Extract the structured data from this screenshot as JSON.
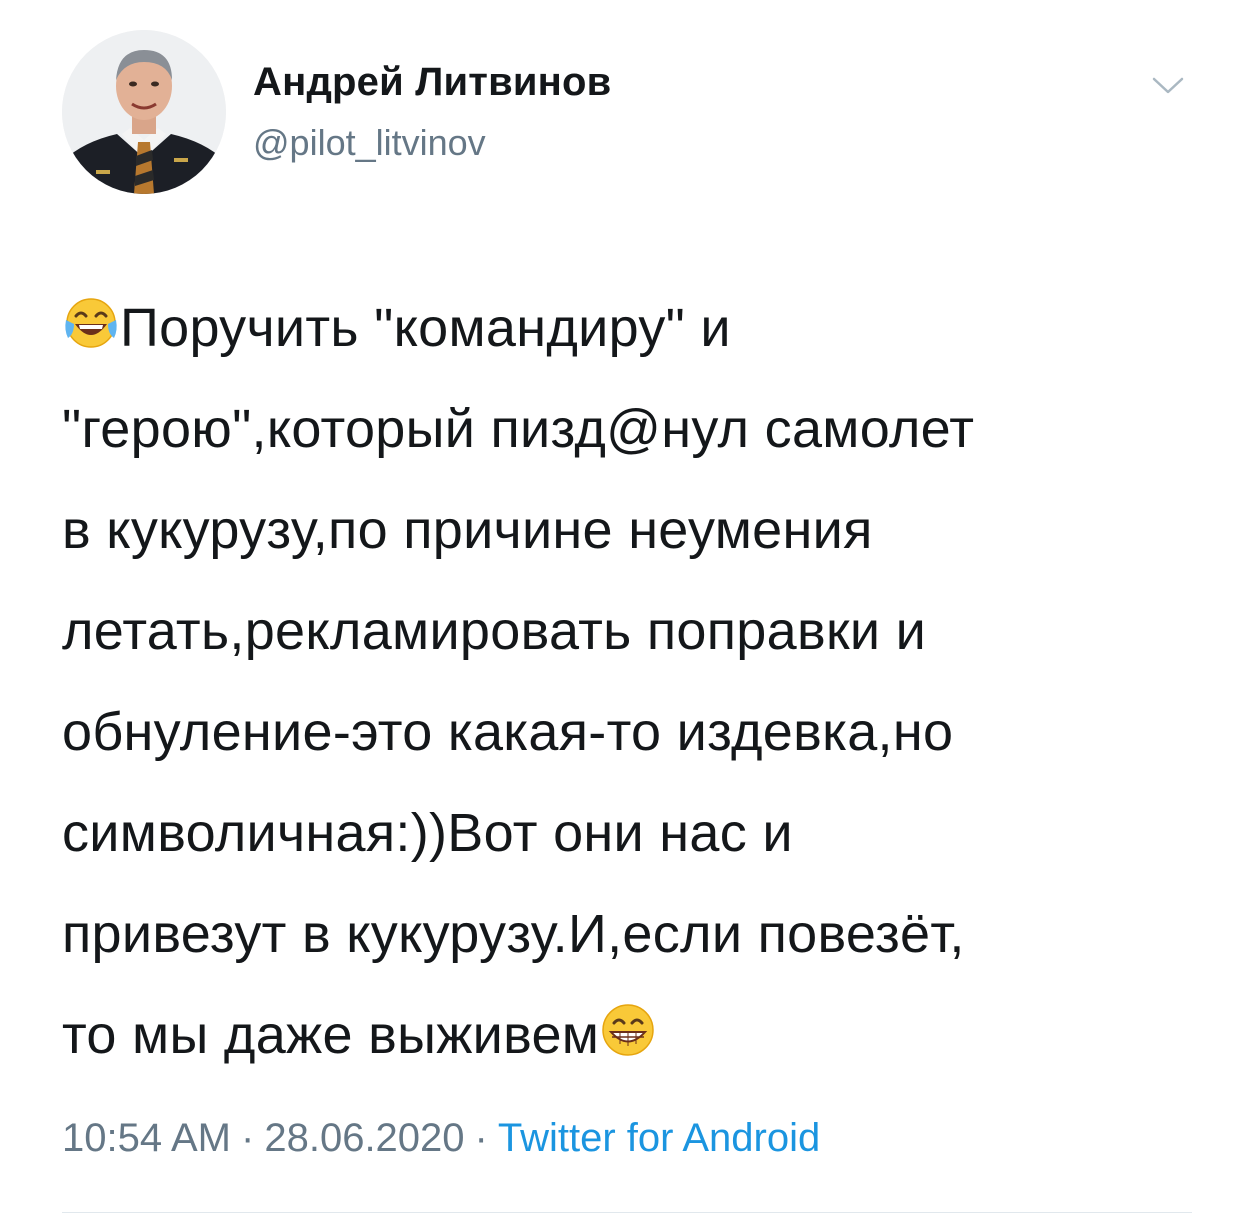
{
  "author": {
    "name": "Андрей Литвинов",
    "handle": "@pilot_litvinov",
    "avatar_icon": "user-avatar"
  },
  "tweet": {
    "lines": [
      "Поручить \"командиру\" и",
      "\"герою\",который пизд@нул самолет",
      "в кукурузу,по причине неумения",
      "летать,рекламировать поправки и",
      "обнуление-это какая-то издевка,но",
      "символичная:))Вот они нас и",
      "привезут в кукурузу.И,если повезёт,",
      "то мы даже выживем"
    ],
    "leading_emoji": "face-with-tears-of-joy-emoji",
    "trailing_emoji": "grinning-face-with-smiling-eyes-emoji"
  },
  "meta": {
    "time": "10:54 AM",
    "separator": "·",
    "date": "28.06.2020",
    "source": "Twitter for Android"
  },
  "menu": {
    "icon": "chevron-down-icon"
  },
  "colors": {
    "text": "#14171a",
    "secondary": "#657786",
    "link": "#1b95e0",
    "divider": "#e1e8ed"
  }
}
